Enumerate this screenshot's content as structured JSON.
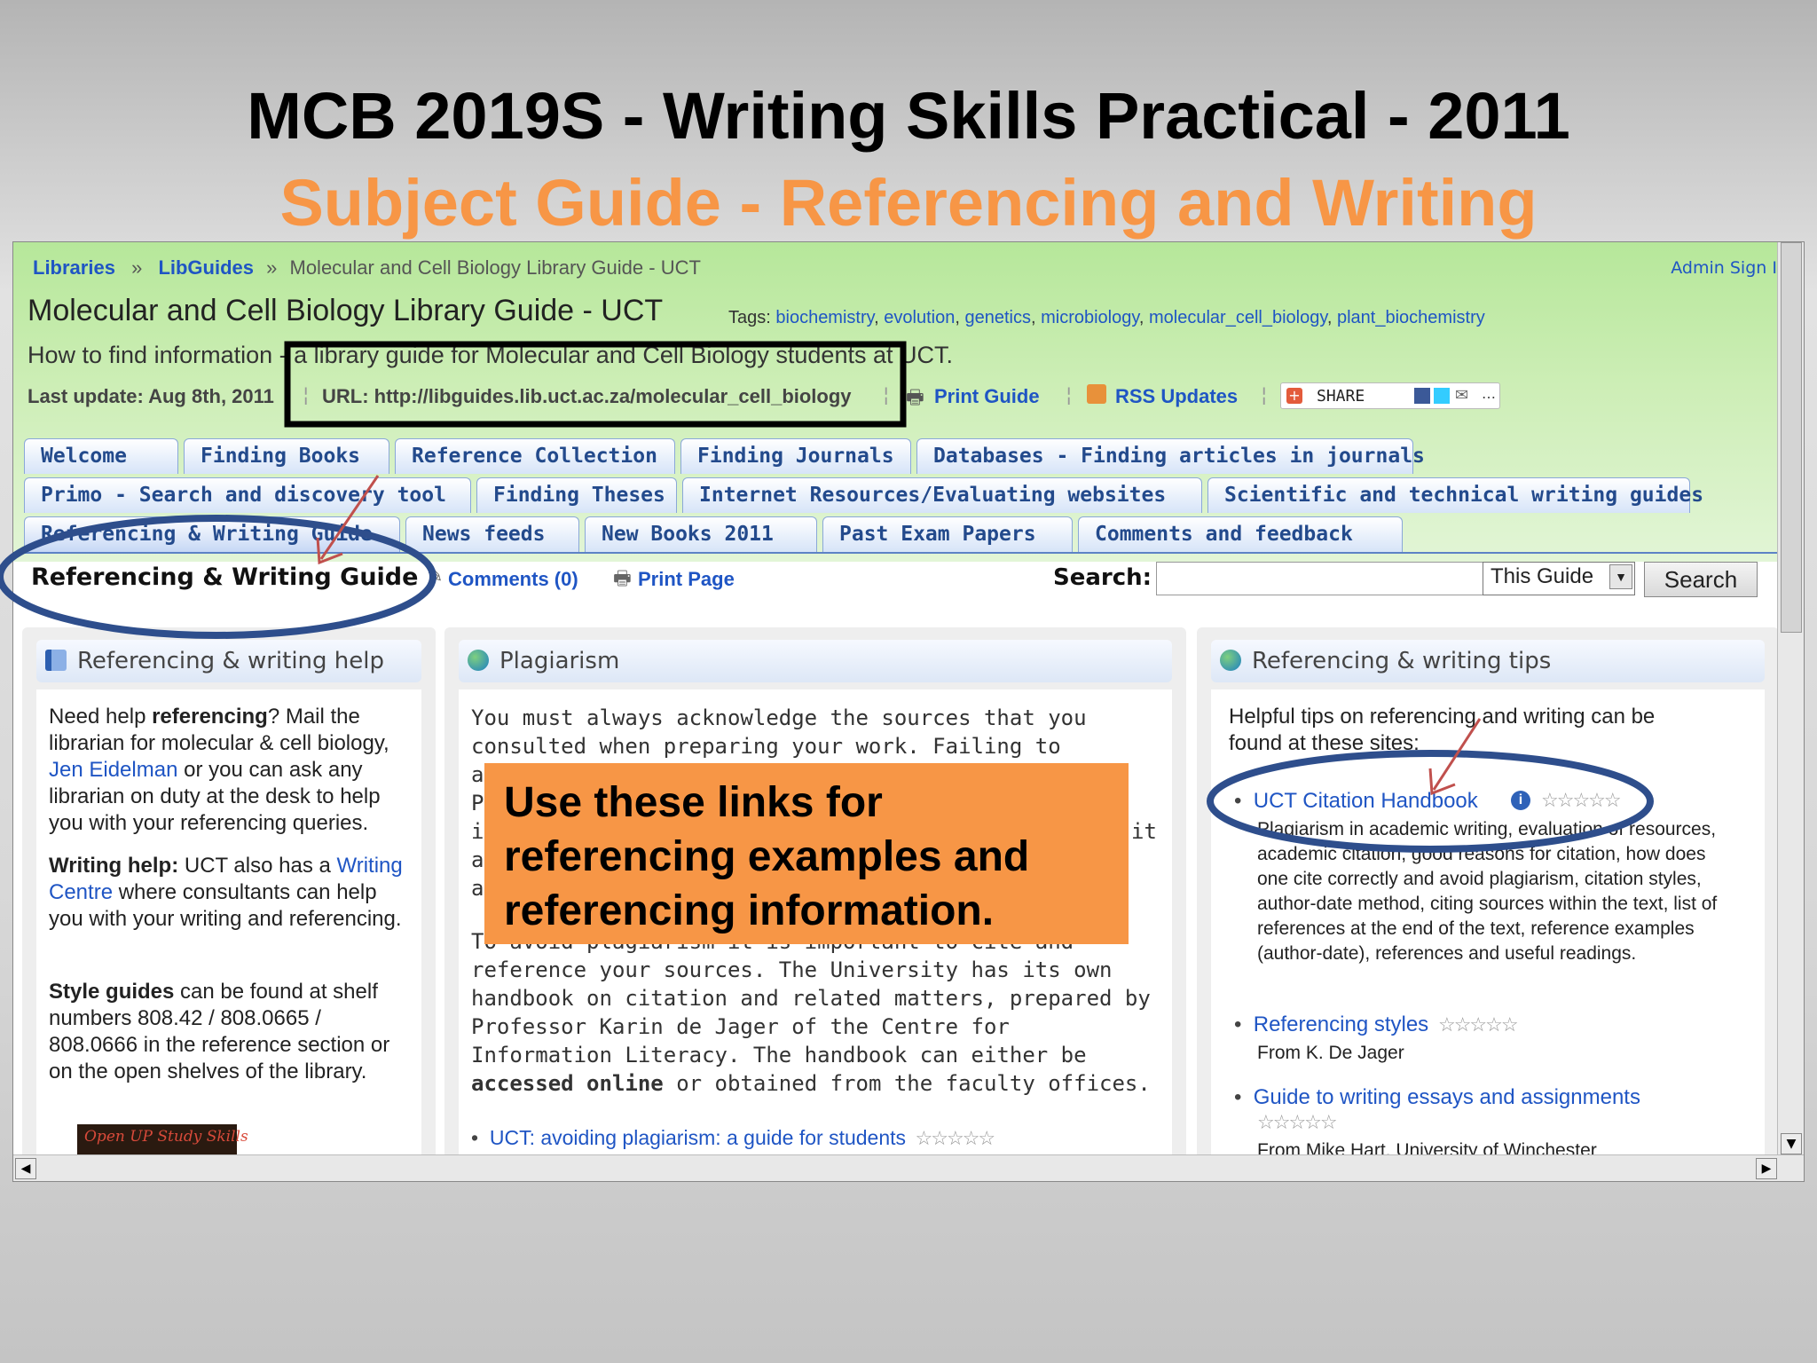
{
  "slide": {
    "title": "MCB 2019S  - Writing Skills Practical -  2011",
    "subtitle": "Subject Guide - Referencing and Writing",
    "callout": [
      "Use these links for",
      "referencing examples and",
      "referencing information."
    ]
  },
  "breadcrumb": {
    "libraries": "Libraries",
    "sep": "»",
    "libguides": "LibGuides",
    "current": "Molecular and Cell Biology Library Guide - UCT",
    "admin": "Admin Sign In"
  },
  "guide": {
    "title": "Molecular and Cell Biology Library Guide - UCT",
    "tags_label": "Tags:",
    "tags": [
      "biochemistry",
      "evolution",
      "genetics",
      "microbiology",
      "molecular_cell_biology",
      "plant_biochemistry"
    ],
    "description": "How to find information - a library guide for Molecular and Cell Biology students at UCT.",
    "last_update": "Last update: Aug 8th, 2011",
    "url": "URL: http://libguides.lib.uct.ac.za/molecular_cell_biology",
    "print_guide": "Print Guide",
    "rss": "RSS Updates",
    "share": "SHARE"
  },
  "tabs": {
    "row1": [
      "Welcome",
      "Finding Books",
      "Reference Collection",
      "Finding Journals",
      "Databases - Finding articles in journals"
    ],
    "row2": [
      "Primo - Search and discovery tool",
      "Finding Theses",
      "Internet Resources/Evaluating websites",
      "Scientific and technical writing guides"
    ],
    "row3": [
      "Referencing & Writing Guide",
      "News feeds",
      "New Books 2011",
      "Past Exam Papers",
      "Comments and feedback"
    ]
  },
  "page_bar": {
    "active_page": "Referencing & Writing Guide",
    "comments": "Comments (0)",
    "print_page": "Print Page",
    "search_label": "Search:",
    "search_value": "",
    "scope": "This Guide",
    "search_button": "Search"
  },
  "left_box": {
    "title": "Referencing & writing help",
    "p1": [
      "Need help ",
      "referencing",
      "? Mail the librarian for molecular & cell biology, ",
      "Jen Eidelman",
      " or you can ask any librarian on duty at the desk to help you with your referencing queries."
    ],
    "p2": [
      "Writing help:",
      " UCT also has a ",
      "Writing Centre",
      " where consultants can help you with your writing and referencing."
    ],
    "p3": [
      "Style guides",
      " can be found at shelf numbers 808.42 / 808.0665 / 808.0666 in the reference section or on the open shelves of the library."
    ],
    "banner": "Open UP Study Skills"
  },
  "mid_box": {
    "title": "Plagiarism",
    "p1_top": "You must always acknowledge the sources that you consulted when preparing your work.  Failing to",
    "p1_hidden": [
      "a",
      "P",
      "id",
      "a",
      "a"
    ],
    "p1_right": "it",
    "p2": [
      "To avoid plagiarism it is important to cite and reference your sources.  The University has its own handbook on citation and related matters, prepared by Professor Karin de Jager of the Centre for Information Literacy.  The handbook can either be ",
      "accessed online",
      " or obtained from the faculty offices."
    ],
    "link": "UCT: avoiding plagiarism: a guide for students"
  },
  "right_box": {
    "title": "Referencing & writing tips",
    "intro": "Helpful tips on referencing and writing can be found at these sites:",
    "items": [
      {
        "label": "UCT Citation Handbook",
        "desc": "Plagiarism in academic writing, evaluation of resources, academic citation, good reasons for citation, how does one cite correctly and avoid plagiarism, citation styles, author-date method, citing sources within the text, list of references at the end of the text, reference examples (author-date), references and useful readings."
      },
      {
        "label": "Referencing styles",
        "desc": "From K. De Jager"
      },
      {
        "label": "Guide to writing essays and assignments",
        "desc": "From Mike Hart, University of Winchester"
      }
    ]
  },
  "colors": {
    "accent_orange": "#f79646",
    "link_blue": "#1f55c4",
    "annotation_navy": "#2e4e8c",
    "arrow_red": "#c0504d"
  }
}
